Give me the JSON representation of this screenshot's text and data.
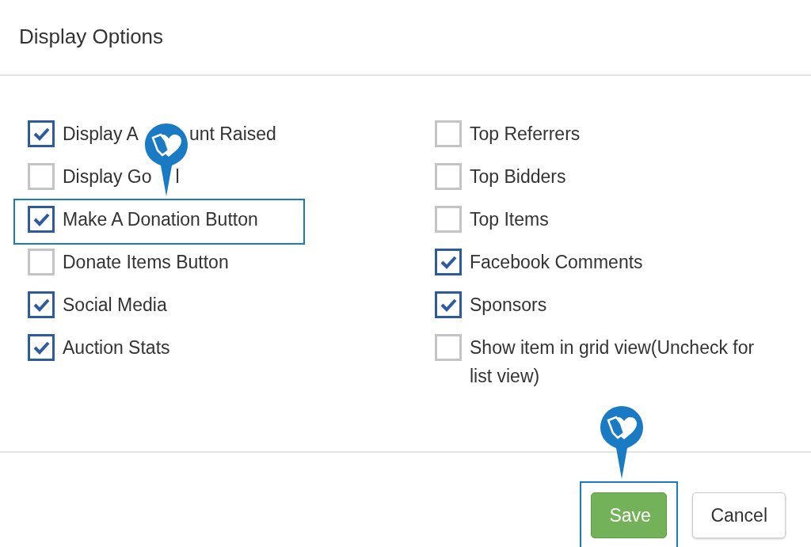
{
  "dialog": {
    "title": "Display Options"
  },
  "options_left": [
    {
      "label_parts": [
        "Display A",
        "unt Raised"
      ],
      "checked": true,
      "highlighted": false
    },
    {
      "label_parts": [
        "Display Go",
        "l"
      ],
      "checked": false,
      "highlighted": false
    },
    {
      "label": "Make A Donation Button",
      "checked": true,
      "highlighted": true
    },
    {
      "label": "Donate Items Button",
      "checked": false,
      "highlighted": false
    },
    {
      "label": "Social Media",
      "checked": true,
      "highlighted": false
    },
    {
      "label": "Auction Stats",
      "checked": true,
      "highlighted": false
    }
  ],
  "options_right": [
    {
      "label": "Top Referrers",
      "checked": false,
      "highlighted": false
    },
    {
      "label": "Top Bidders",
      "checked": false,
      "highlighted": false
    },
    {
      "label": "Top Items",
      "checked": false,
      "highlighted": false
    },
    {
      "label": "Facebook Comments",
      "checked": true,
      "highlighted": false
    },
    {
      "label": "Sponsors",
      "checked": true,
      "highlighted": false
    },
    {
      "label": "Show item in grid view(Uncheck for list view)",
      "checked": false,
      "highlighted": false
    }
  ],
  "buttons": [
    {
      "label": "Save",
      "kind": "primary",
      "highlighted": true
    },
    {
      "label": "Cancel",
      "kind": "secondary",
      "highlighted": false
    }
  ]
}
